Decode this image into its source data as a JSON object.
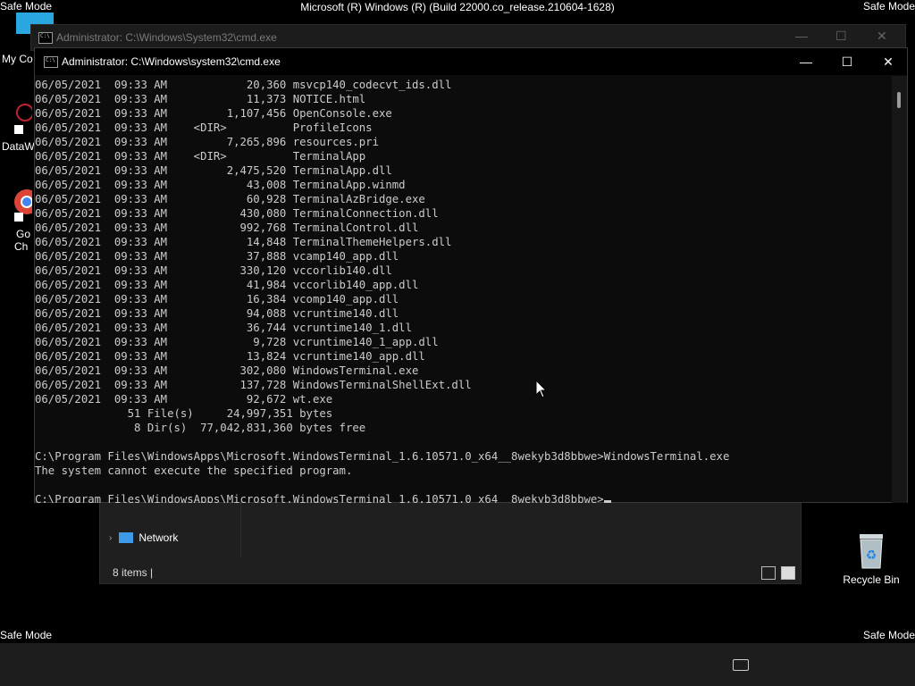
{
  "top_title": "Microsoft (R) Windows (R) (Build 22000.co_release.210604-1628)",
  "safe_mode": "Safe Mode",
  "desktop_labels": [
    "My Co",
    "DataW",
    "Go",
    "Ch"
  ],
  "bg_window": {
    "title": "Administrator: C:\\Windows\\System32\\cmd.exe"
  },
  "window": {
    "title": "Administrator: C:\\Windows\\system32\\cmd.exe",
    "minimize": "—",
    "maximize": "☐",
    "close": "✕"
  },
  "console_lines": [
    "06/05/2021  09:33 AM            20,360 msvcp140_codecvt_ids.dll",
    "06/05/2021  09:33 AM            11,373 NOTICE.html",
    "06/05/2021  09:33 AM         1,107,456 OpenConsole.exe",
    "06/05/2021  09:33 AM    <DIR>          ProfileIcons",
    "06/05/2021  09:33 AM         7,265,896 resources.pri",
    "06/05/2021  09:33 AM    <DIR>          TerminalApp",
    "06/05/2021  09:33 AM         2,475,520 TerminalApp.dll",
    "06/05/2021  09:33 AM            43,008 TerminalApp.winmd",
    "06/05/2021  09:33 AM            60,928 TerminalAzBridge.exe",
    "06/05/2021  09:33 AM           430,080 TerminalConnection.dll",
    "06/05/2021  09:33 AM           992,768 TerminalControl.dll",
    "06/05/2021  09:33 AM            14,848 TerminalThemeHelpers.dll",
    "06/05/2021  09:33 AM            37,888 vcamp140_app.dll",
    "06/05/2021  09:33 AM           330,120 vccorlib140.dll",
    "06/05/2021  09:33 AM            41,984 vccorlib140_app.dll",
    "06/05/2021  09:33 AM            16,384 vcomp140_app.dll",
    "06/05/2021  09:33 AM            94,088 vcruntime140.dll",
    "06/05/2021  09:33 AM            36,744 vcruntime140_1.dll",
    "06/05/2021  09:33 AM             9,728 vcruntime140_1_app.dll",
    "06/05/2021  09:33 AM            13,824 vcruntime140_app.dll",
    "06/05/2021  09:33 AM           302,080 WindowsTerminal.exe",
    "06/05/2021  09:33 AM           137,728 WindowsTerminalShellExt.dll",
    "06/05/2021  09:33 AM            92,672 wt.exe",
    "              51 File(s)     24,997,351 bytes",
    "               8 Dir(s)  77,042,831,360 bytes free",
    "",
    "C:\\Program Files\\WindowsApps\\Microsoft.WindowsTerminal_1.6.10571.0_x64__8wekyb3d8bbwe>WindowsTerminal.exe",
    "The system cannot execute the specified program.",
    "",
    "C:\\Program Files\\WindowsApps\\Microsoft.WindowsTerminal_1.6.10571.0_x64__8wekyb3d8bbwe>"
  ],
  "explorer": {
    "nav_item": "Network",
    "status": "8 items"
  },
  "recycle_bin": "Recycle Bin",
  "colors": {
    "console_bg": "#0c0c0c",
    "console_text": "#cccccc",
    "taskbar": "#1d1d1d"
  }
}
